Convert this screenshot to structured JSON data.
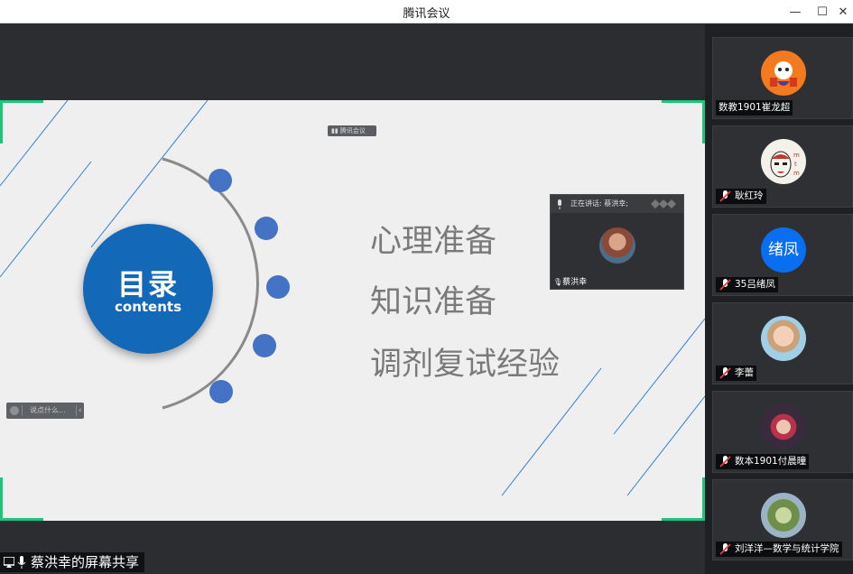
{
  "window": {
    "title": "腾讯会议",
    "minimize": "—",
    "maximize": "☐",
    "close": "✕"
  },
  "share": {
    "label": "蔡洪幸的屏幕共享",
    "top_tag": "▮▮ 腾讯会议",
    "say_placeholder": "说点什么..."
  },
  "slide": {
    "toc_title": "目录",
    "toc_subtitle": "contents",
    "items": [
      "心理准备",
      "知识准备",
      "调剂复试经验"
    ],
    "accent_color": "#1468b8",
    "dot_color": "#4472c4"
  },
  "mini_video": {
    "header": "正在讲话: 蔡洪幸;",
    "name": "蔡洪幸"
  },
  "participants": [
    {
      "name": "数教1901崔龙超",
      "avatar": "orange-cartoon",
      "muted": false
    },
    {
      "name": "耿红玲",
      "avatar": "opera-mask",
      "muted": true
    },
    {
      "name": "35吕绪凤",
      "avatar_text": "绪凤",
      "avatar": "text",
      "muted": true
    },
    {
      "name": "李蕾",
      "avatar": "girl-photo",
      "muted": true
    },
    {
      "name": "数本1901付晨曈",
      "avatar": "night-photo",
      "muted": true
    },
    {
      "name": "刘洋洋—数学与统计学院",
      "avatar": "green-photo",
      "muted": true
    }
  ]
}
